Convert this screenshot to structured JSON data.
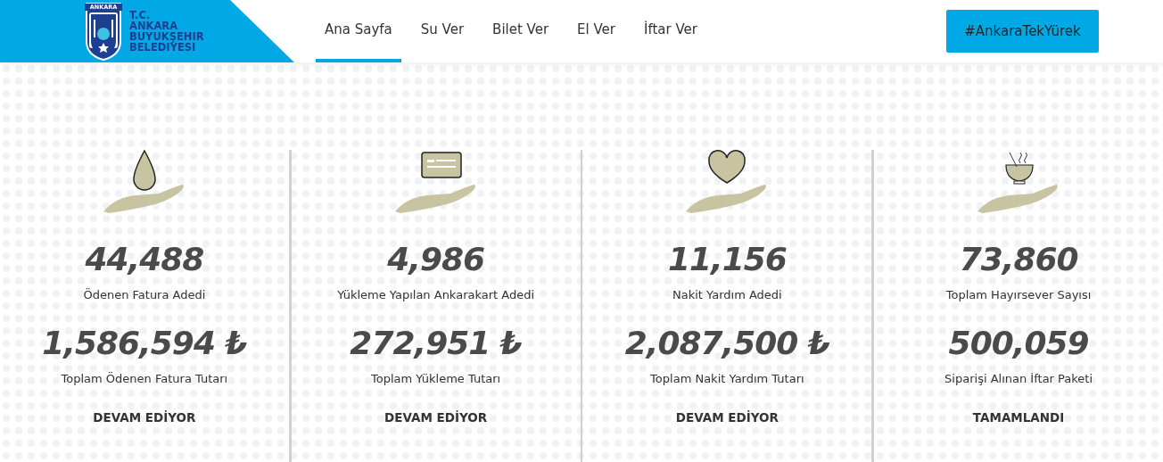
{
  "logo": {
    "badge_text": "ANKARA",
    "lines": [
      "T.C.",
      "ANKARA",
      "BUYUKŞEHIR",
      "BELEDIYESI"
    ]
  },
  "nav": [
    {
      "label": "Ana Sayfa",
      "selected": true
    },
    {
      "label": "Su Ver",
      "selected": false
    },
    {
      "label": "Bilet Ver",
      "selected": false
    },
    {
      "label": "El Ver",
      "selected": false
    },
    {
      "label": "İftar Ver",
      "selected": false
    }
  ],
  "cta_button": "#AnkaraTekYürek",
  "stats": [
    {
      "kind": "drop",
      "count": "44,488",
      "count_label": "Ödenen Fatura Adedi",
      "total": "1,586,594 ₺",
      "total_label": "Toplam Ödenen Fatura Tutarı",
      "status": "DEVAM EDİYOR"
    },
    {
      "kind": "card",
      "count": "4,986",
      "count_label": "Yükleme Yapılan Ankarakart Adedi",
      "total": "272,951 ₺",
      "total_label": "Toplam Yükleme Tutarı",
      "status": "DEVAM EDİYOR"
    },
    {
      "kind": "heart",
      "count": "11,156",
      "count_label": "Nakit Yardım Adedi",
      "total": "2,087,500 ₺",
      "total_label": "Toplam Nakit Yardım Tutarı",
      "status": "DEVAM EDİYOR"
    },
    {
      "kind": "bowl",
      "count": "73,860",
      "count_label": "Toplam Hayırsever Sayısı",
      "total": "500,059",
      "total_label": "Siparişi Alınan İftar Paketi",
      "status": "TAMAMLANDI"
    }
  ]
}
